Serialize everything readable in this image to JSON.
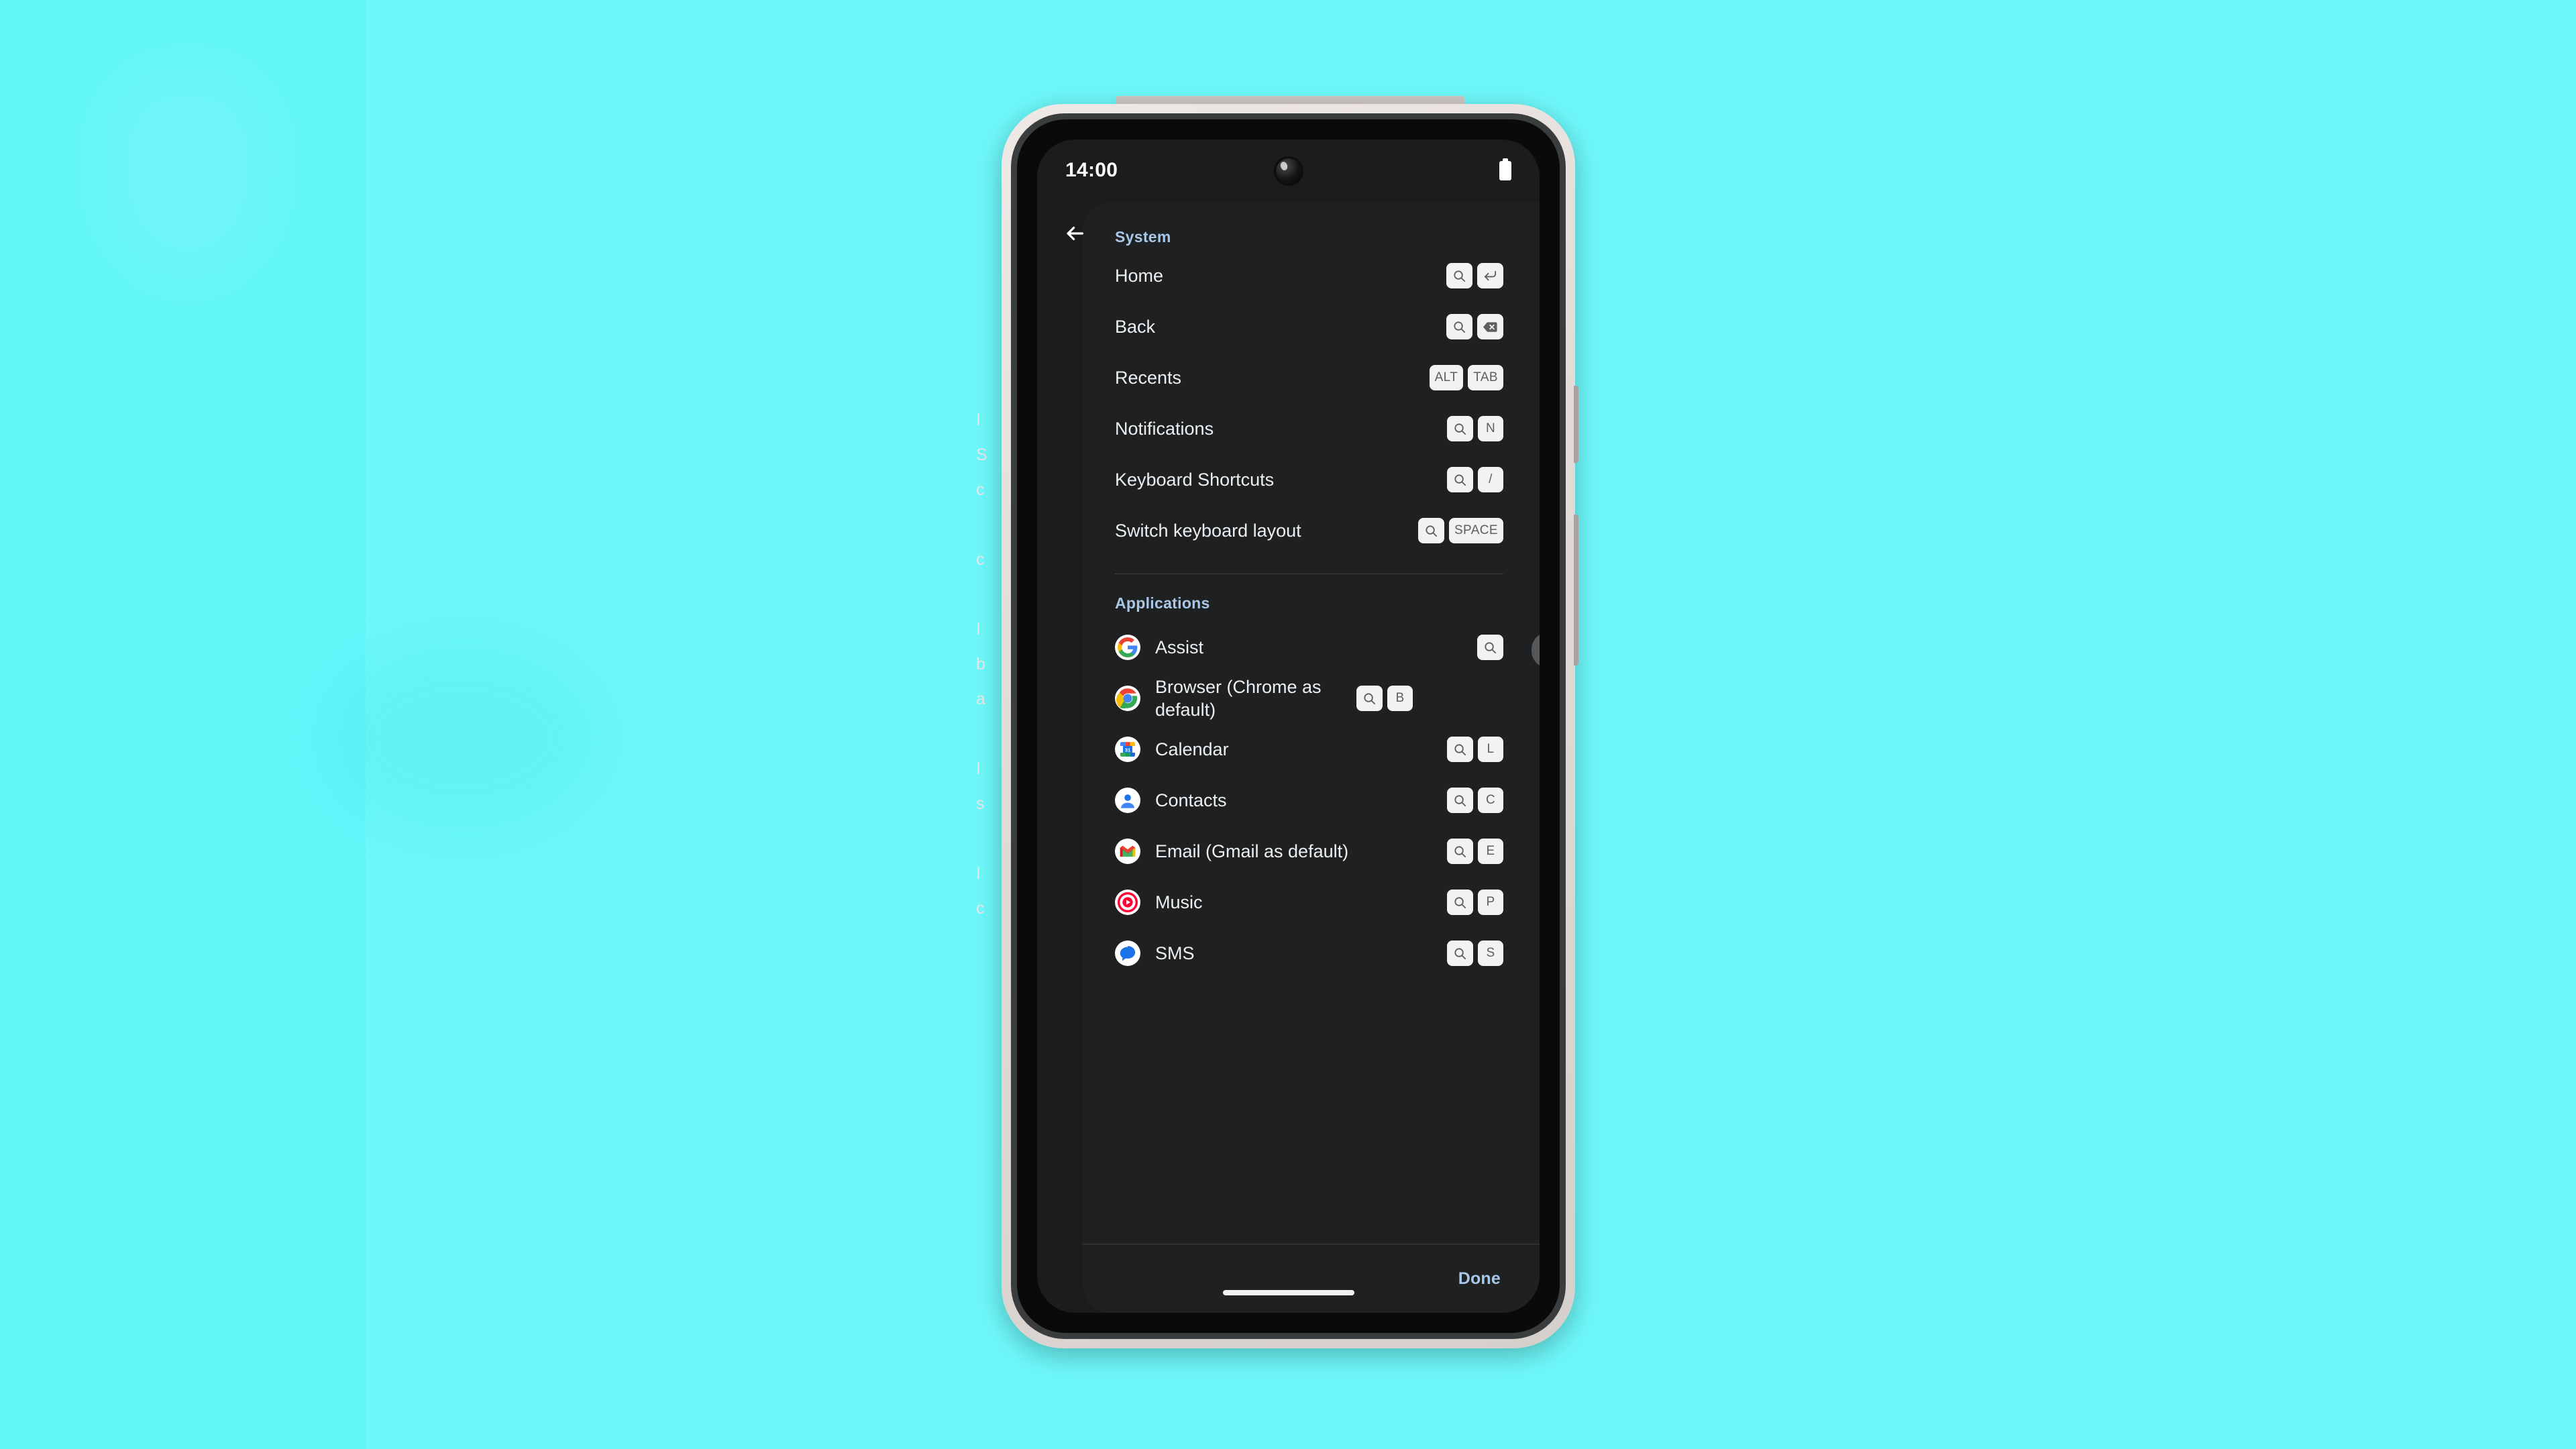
{
  "background": {
    "color": "#63f6f9",
    "obscured_lines": [
      "I",
      "S",
      "c",
      "",
      "c",
      "",
      "I",
      "b",
      "a",
      "",
      "I",
      "s",
      "",
      "I",
      "c"
    ]
  },
  "phone": {
    "status_bar": {
      "time": "14:00",
      "battery_icon": "battery-full-icon",
      "camera_icon": "front-camera-punch-hole"
    },
    "gesture_bar": "home-gesture-indicator"
  },
  "dialog": {
    "back_label": "Back",
    "sections": [
      {
        "title": "System",
        "rows": [
          {
            "label": "Home",
            "keys": [
              "search-icon",
              "enter-icon"
            ]
          },
          {
            "label": "Back",
            "keys": [
              "search-icon",
              "backspace-icon"
            ]
          },
          {
            "label": "Recents",
            "keys": [
              "ALT",
              "TAB"
            ]
          },
          {
            "label": "Notifications",
            "keys": [
              "search-icon",
              "N"
            ]
          },
          {
            "label": "Keyboard Shortcuts",
            "keys": [
              "search-icon",
              "/"
            ]
          },
          {
            "label": "Switch keyboard layout",
            "keys": [
              "search-icon",
              "SPACE"
            ]
          }
        ]
      },
      {
        "title": "Applications",
        "rows": [
          {
            "icon": "google-assist-icon",
            "label": "Assist",
            "keys": [
              "search-icon"
            ]
          },
          {
            "icon": "chrome-icon",
            "label": "Browser (Chrome as default)",
            "keys": [
              "search-icon",
              "B"
            ]
          },
          {
            "icon": "google-calendar-icon",
            "label": "Calendar",
            "keys": [
              "search-icon",
              "L"
            ]
          },
          {
            "icon": "google-contacts-icon",
            "label": "Contacts",
            "keys": [
              "search-icon",
              "C"
            ]
          },
          {
            "icon": "gmail-icon",
            "label": "Email (Gmail as default)",
            "keys": [
              "search-icon",
              "E"
            ]
          },
          {
            "icon": "youtube-music-icon",
            "label": "Music",
            "keys": [
              "search-icon",
              "P"
            ]
          },
          {
            "icon": "google-messages-icon",
            "label": "SMS",
            "keys": [
              "search-icon",
              "S"
            ]
          }
        ]
      }
    ],
    "done_label": "Done"
  },
  "colors": {
    "backdrop": "#63f6f9",
    "screen_bg": "#1b1c1e",
    "dialog_bg": "#1f2021",
    "accent": "#a9c8e8",
    "key_bg": "#f2f2f2",
    "key_fg": "#5c5f61",
    "text": "#eceff1"
  }
}
